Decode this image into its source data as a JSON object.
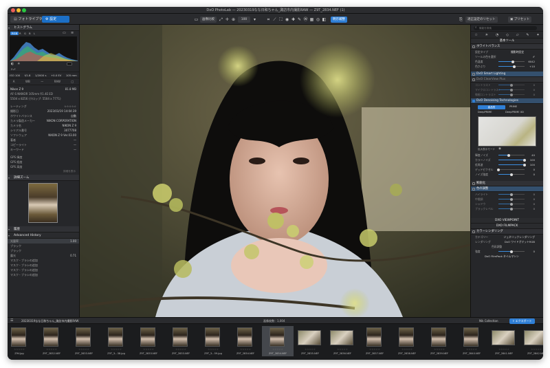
{
  "window": {
    "title": "DxO PhotoLab — 20230319なな日和ちゃん_諏訪市内撮影RAW — Z9T_2834.NEF (1)"
  },
  "toolbar": {
    "tab_library": "フォトライブラリ",
    "tab_customize": "設定",
    "compare_label": "画像比較",
    "zoom": "100",
    "history_label": "明示補整",
    "reset_label": "適正設定のリセット",
    "preset_label": "プリセット"
  },
  "left": {
    "histogram_title": "ヒストグラム",
    "histogram_channels": [
      "RGB",
      "R",
      "G",
      "B",
      "L"
    ],
    "exposure_readouts": [
      "ISO 100",
      "f/1.8",
      "1/2000 s",
      "+0.0 EV",
      "105 mm"
    ],
    "modes": [
      "A",
      "WB",
      "—",
      "RAW",
      "□"
    ],
    "camera": "Nikon Z 9",
    "size": "81.8 MB",
    "lens": "AF-S NIKKOR 105mm f/1.4E ED",
    "dims": "5504 x 8256 (クロップ: 5504 x 7771)",
    "meta_rows": [
      {
        "k": "レーティング",
        "v": "☆☆☆☆☆"
      },
      {
        "k": "撮影日",
        "v": "2023/03/19 14:04:39"
      },
      {
        "k": "ホワイトバランス",
        "v": "自動"
      },
      {
        "k": "カメラ製造メーカー",
        "v": "NIKON CORPORATION"
      },
      {
        "k": "カメラ名",
        "v": "NIKON Z 9"
      },
      {
        "k": "シリアル番号",
        "v": "3077708"
      },
      {
        "k": "ソフトウェア",
        "v": "NIKON Z 9 Ver.03.00"
      },
      {
        "k": "著者",
        "v": "—"
      },
      {
        "k": "コピーライト",
        "v": "—"
      },
      {
        "k": "キーワード",
        "v": "—"
      }
    ],
    "gps_rows": [
      "GPS 緯度",
      "GPS 経度",
      "GPS 高度"
    ],
    "gps_link": "詳細を表示",
    "navigator_title": "詳細ズーム",
    "history_title": "履歴",
    "advanced_history_title": "Advanced History",
    "history_items": [
      {
        "k": "光量率",
        "v": "1.00"
      },
      {
        "k": "ブラック",
        "v": ""
      },
      {
        "k": "ブラック",
        "v": ""
      },
      {
        "k": "露光",
        "v": "0.71"
      },
      {
        "k": "マスク・ブラシの追加",
        "v": ""
      },
      {
        "k": "マスク・ブラシの追加",
        "v": ""
      },
      {
        "k": "マスク・ブラシの追加",
        "v": ""
      },
      {
        "k": "マスク・ブラシの追加",
        "v": ""
      }
    ]
  },
  "right": {
    "search_placeholder": "機能を検索",
    "base_tool_title": "基本ツール",
    "wb_title": "ホワイトバランス",
    "wb_rows": [
      {
        "label": "色温度",
        "value": "6042",
        "level": 0.55
      },
      {
        "label": "色かぶり",
        "value": "+10",
        "level": 0.6
      }
    ],
    "wb_mode": "撮影時設定",
    "smart_lighting": "DxO Smart Lighting",
    "clearview": "DxO ClearView Plus",
    "clearview_rows": [
      {
        "label": "コントラスト",
        "value": "0",
        "level": 0.5
      },
      {
        "label": "マイクロコントラスト",
        "value": "0",
        "level": 0.5
      },
      {
        "label": "微細コントラスト",
        "value": "0",
        "level": 0.5
      }
    ],
    "denoise_title": "DxO Denoising Technologies",
    "denoise_mode": "高品質",
    "denoise_options": [
      "PRIME",
      "DeepPRIME",
      "DeepPRIME XD"
    ],
    "denoise_preview_label": "拡大表示モード",
    "denoise_rows": [
      {
        "label": "輝度ノイズ",
        "value": "40",
        "level": 0.4
      },
      {
        "label": "カラーノイズ",
        "value": "100",
        "level": 1.0
      },
      {
        "label": "低周波",
        "value": "100",
        "level": 1.0
      },
      {
        "label": "デッドピクセル",
        "value": "0",
        "level": 0.0
      },
      {
        "label": "ノイズ強度",
        "value": "0",
        "level": 0.5
      }
    ],
    "sharpen_title": "鮮鋭化",
    "tone_title": "色の調整",
    "tone_rows": [
      {
        "label": "ハイライト",
        "value": "0",
        "level": 0.5
      },
      {
        "label": "中間調",
        "value": "0",
        "level": 0.5
      },
      {
        "label": "シャドウ",
        "value": "0",
        "level": 0.5
      },
      {
        "label": "ブラックレベル",
        "value": "0",
        "level": 0.5
      }
    ],
    "viewpoint_title": "DXO VIEWPOINT",
    "filmpack_title": "DXO FILMPACK",
    "rendering_title": "カラーレンダリング",
    "rendering_rows": [
      {
        "label": "カテゴリー",
        "value": "ジェネリックレンダリング"
      },
      {
        "label": "レンダリング",
        "value": "DxO ワイドガマットRGB"
      }
    ],
    "fine_adjust_title": "色彩調整",
    "fine_rows": [
      {
        "label": "強度",
        "value": "0",
        "level": 0.5
      }
    ],
    "filmpack_timemachine": "DxO FilmPack タイムマシン"
  },
  "bottom": {
    "folder_path": "20230319なな日和ちゃん_諏訪市内撮影RAW",
    "count": "画像枚数：1,004",
    "nik_label": "Nik Collection",
    "export_label": "エクスポート"
  },
  "filmstrip": [
    {
      "name": "Z9V.jpg",
      "orient": "portrait",
      "sel": false
    },
    {
      "name": "Z9T_2832.NEF",
      "orient": "portrait",
      "sel": false
    },
    {
      "name": "Z9T_2833.NEF",
      "orient": "portrait",
      "sel": false
    },
    {
      "name": "Z9T_3...38.jpg",
      "orient": "portrait",
      "sel": false
    },
    {
      "name": "Z9T_2833.NEF",
      "orient": "portrait",
      "sel": false
    },
    {
      "name": "Z9T_2833.NEF",
      "orient": "portrait",
      "sel": false
    },
    {
      "name": "Z9T_3...59.jpg",
      "orient": "portrait",
      "sel": false
    },
    {
      "name": "Z9T_2834.NEF",
      "orient": "portrait",
      "sel": false
    },
    {
      "name": "Z9T_2834.NEF",
      "orient": "portrait",
      "sel": true
    },
    {
      "name": "Z9T_2835.NEF",
      "orient": "landscape",
      "sel": false
    },
    {
      "name": "Z9T_2836.NEF",
      "orient": "landscape",
      "sel": false
    },
    {
      "name": "Z9T_2837.NEF",
      "orient": "portrait",
      "sel": false
    },
    {
      "name": "Z9T_2838.NEF",
      "orient": "portrait",
      "sel": false
    },
    {
      "name": "Z9T_2839.NEF",
      "orient": "portrait",
      "sel": false
    },
    {
      "name": "Z9T_2840.NEF",
      "orient": "portrait",
      "sel": false
    },
    {
      "name": "Z9T_2841.NEF",
      "orient": "landscape",
      "sel": false
    },
    {
      "name": "Z9T_2842.NEF",
      "orient": "landscape",
      "sel": false
    }
  ],
  "colors": {
    "accent": "#2f7fd6",
    "panel": "#26272a",
    "header": "#303135"
  }
}
